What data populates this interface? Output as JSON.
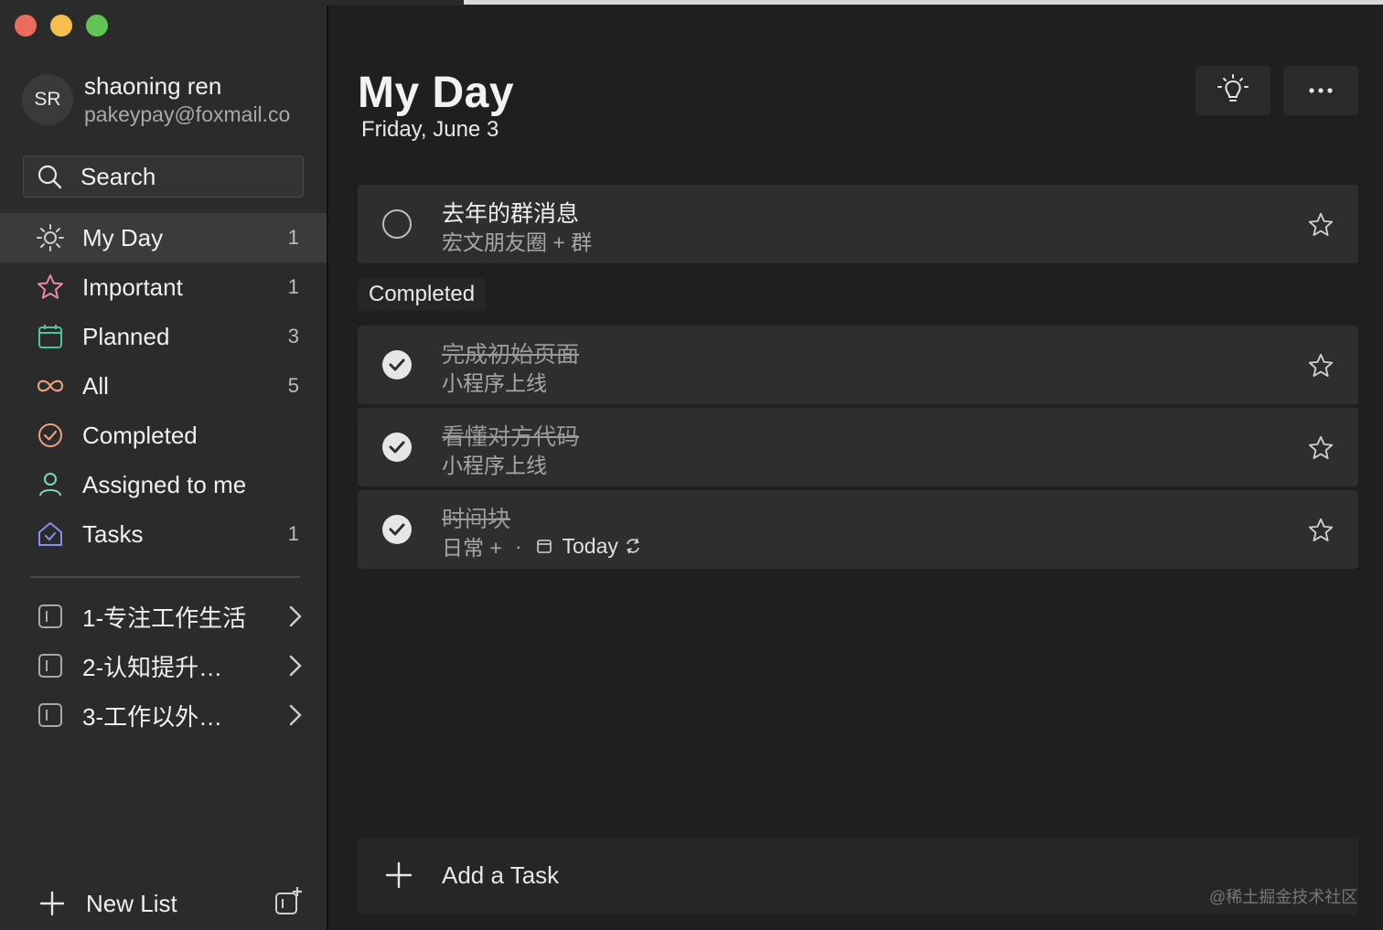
{
  "window": {
    "controls": [
      "close",
      "minimize",
      "zoom"
    ]
  },
  "profile": {
    "initials": "SR",
    "name": "shaoning ren",
    "email": "pakeypay@foxmail.co"
  },
  "search": {
    "label": "Search"
  },
  "nav": {
    "items": [
      {
        "label": "My Day",
        "count": "1",
        "icon": "sun-icon",
        "color": "#c8c8c8"
      },
      {
        "label": "Important",
        "count": "1",
        "icon": "star-icon",
        "color": "#e98aa8"
      },
      {
        "label": "Planned",
        "count": "3",
        "icon": "calendar-icon",
        "color": "#4fc3a1"
      },
      {
        "label": "All",
        "count": "5",
        "icon": "infinity-icon",
        "color": "#e5a07c"
      },
      {
        "label": "Completed",
        "count": "",
        "icon": "check-circle-icon",
        "color": "#e5a07c"
      },
      {
        "label": "Assigned to me",
        "count": "",
        "icon": "person-icon",
        "color": "#7fd8b4"
      },
      {
        "label": "Tasks",
        "count": "1",
        "icon": "home-icon",
        "color": "#8d8df0"
      }
    ]
  },
  "lists": {
    "groups": [
      {
        "label": "1-专注工作生活"
      },
      {
        "label": "2-认知提升…"
      },
      {
        "label": "3-工作以外…"
      }
    ]
  },
  "sidebar_footer": {
    "new_list": "New List"
  },
  "header": {
    "title": "My Day",
    "date": "Friday, June 3"
  },
  "tasks": {
    "open": [
      {
        "title": "去年的群消息",
        "subtitle": "宏文朋友圈 + 群"
      }
    ],
    "completed_label": "Completed",
    "completed": [
      {
        "title": "完成初始页面",
        "subtitle": "小程序上线"
      },
      {
        "title": "看懂对方代码",
        "subtitle": "小程序上线"
      },
      {
        "title": "时间块",
        "subtitle": "日常 +",
        "dot": "·",
        "due": "Today"
      }
    ]
  },
  "add_task": {
    "label": "Add a Task"
  },
  "watermark": "@稀土掘金技术社区"
}
